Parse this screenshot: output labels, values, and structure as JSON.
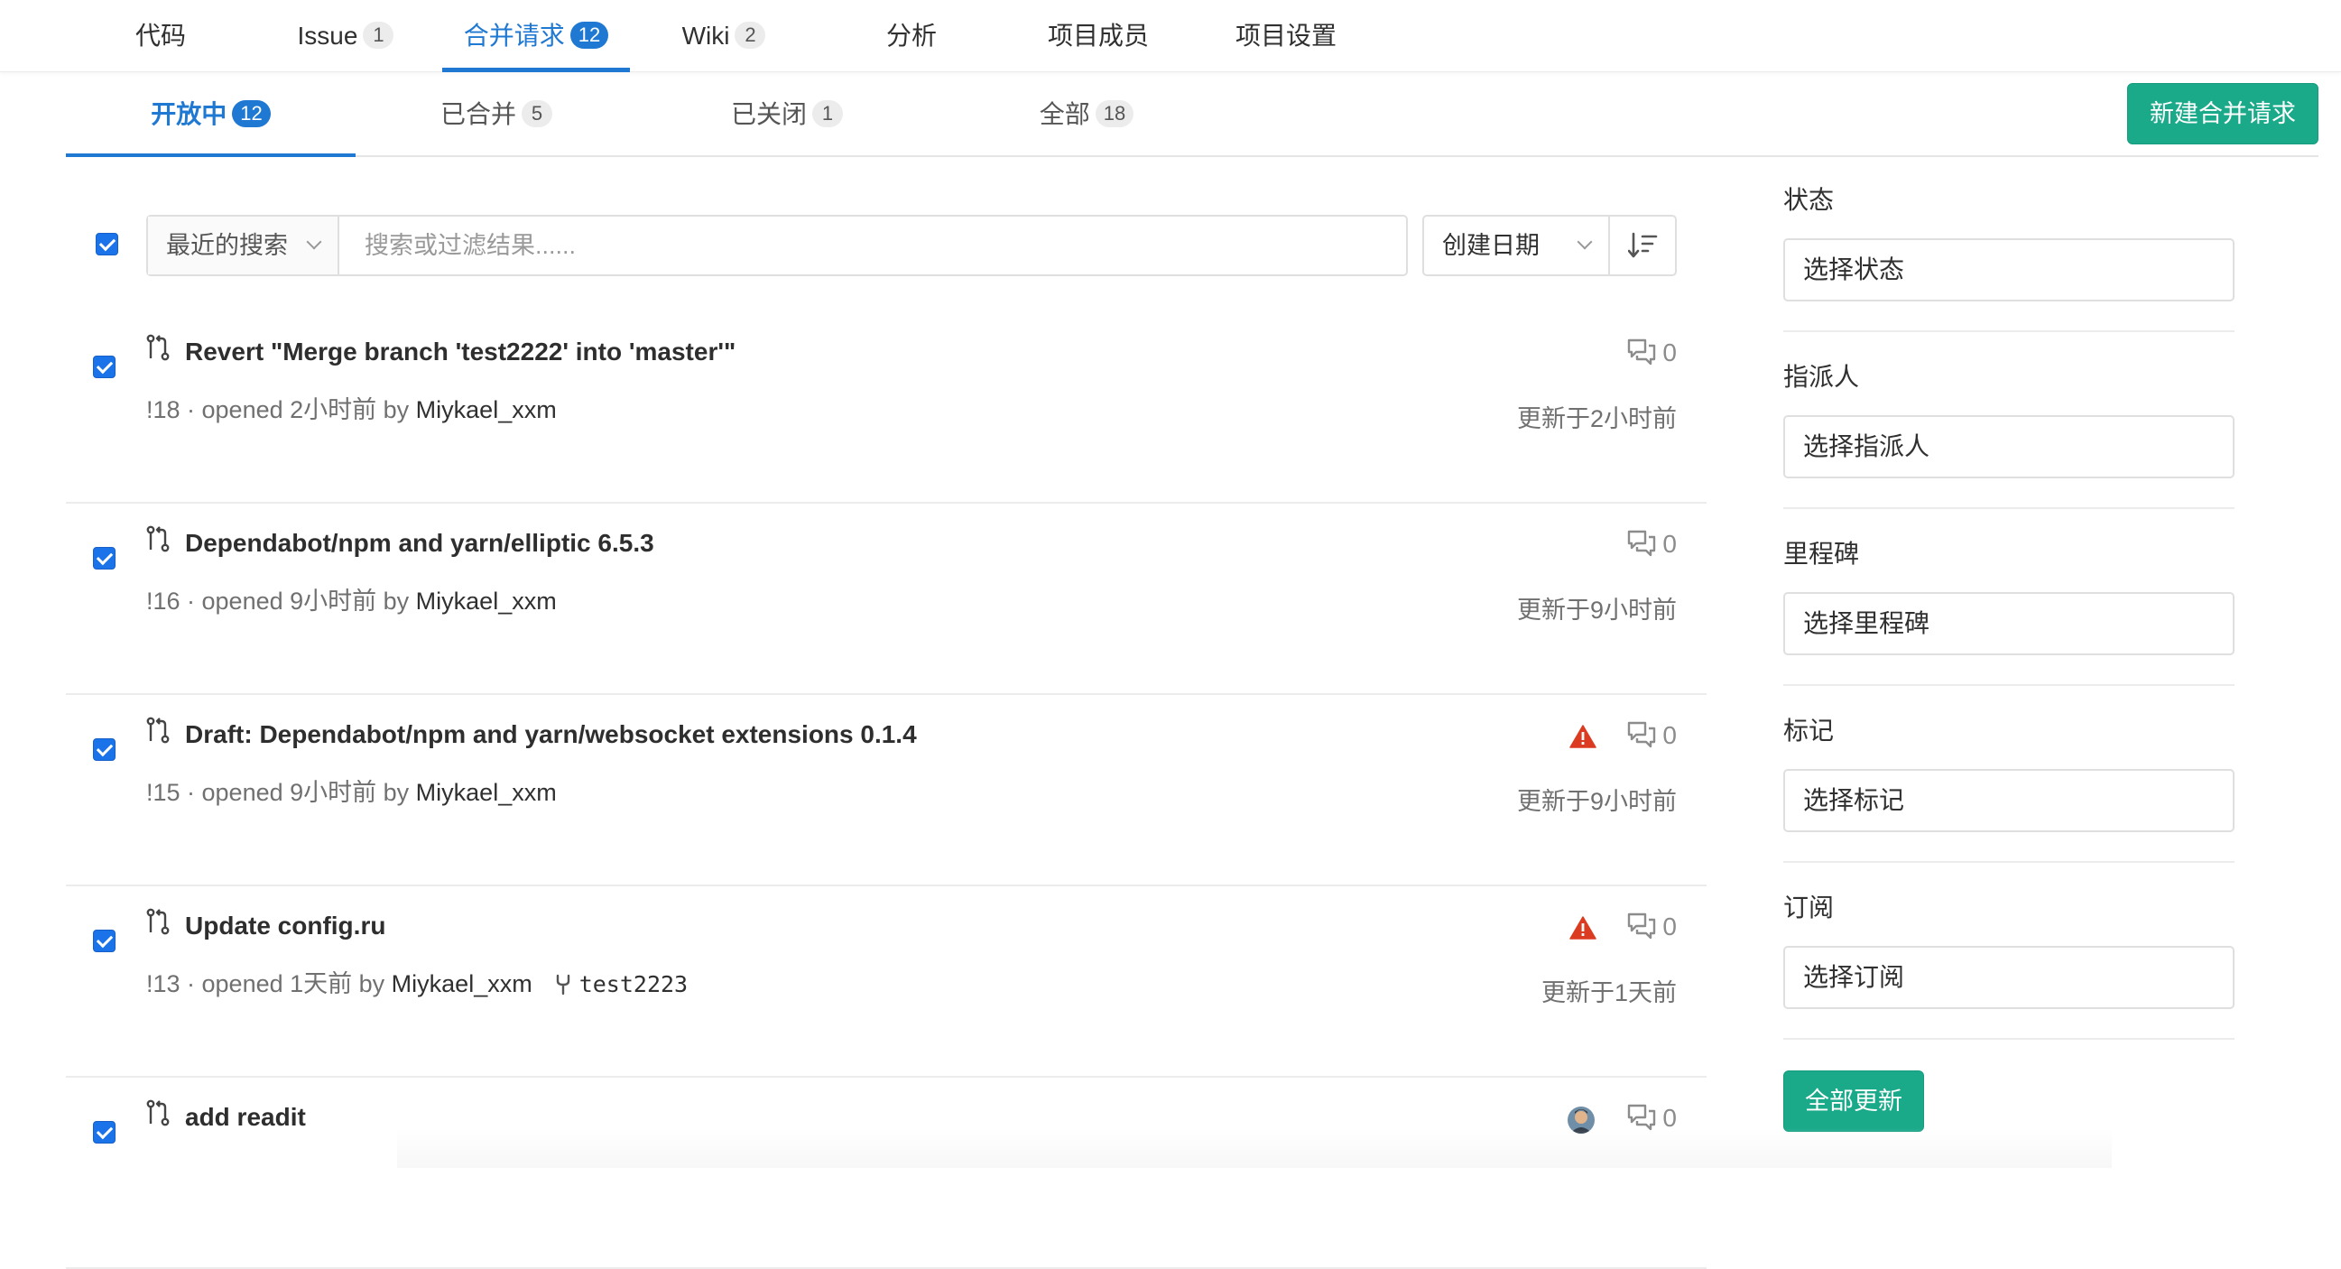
{
  "nav": {
    "tabs": [
      {
        "label": "代码",
        "count": null
      },
      {
        "label": "Issue",
        "count": "1"
      },
      {
        "label": "合并请求",
        "count": "12"
      },
      {
        "label": "Wiki",
        "count": "2"
      },
      {
        "label": "分析",
        "count": null
      },
      {
        "label": "项目成员",
        "count": null
      },
      {
        "label": "项目设置",
        "count": null
      }
    ],
    "active": "合并请求"
  },
  "states": {
    "tabs": [
      {
        "label": "开放中",
        "count": "12"
      },
      {
        "label": "已合并",
        "count": "5"
      },
      {
        "label": "已关闭",
        "count": "1"
      },
      {
        "label": "全部",
        "count": "18"
      }
    ],
    "active": "开放中",
    "new_button": "新建合并请求"
  },
  "filter": {
    "recent_label": "最近的搜索",
    "placeholder": "搜索或过滤结果......",
    "sort_label": "创建日期"
  },
  "merge_requests": [
    {
      "title": "Revert \"Merge branch 'test2222' into 'master'\"",
      "meta": "!18 · opened 2小时前 by ",
      "author": "Miykael_xxm",
      "branch": "",
      "updated": "更新于2小时前",
      "comments": "0",
      "warning": false,
      "avatar": false
    },
    {
      "title": "Dependabot/npm and yarn/elliptic 6.5.3",
      "meta": "!16 · opened 9小时前 by ",
      "author": "Miykael_xxm",
      "branch": "",
      "updated": "更新于9小时前",
      "comments": "0",
      "warning": false,
      "avatar": false
    },
    {
      "title": "Draft: Dependabot/npm and yarn/websocket extensions 0.1.4",
      "meta": "!15 · opened 9小时前 by ",
      "author": "Miykael_xxm",
      "branch": "",
      "updated": "更新于9小时前",
      "comments": "0",
      "warning": true,
      "avatar": false
    },
    {
      "title": "Update config.ru",
      "meta": "!13 · opened 1天前 by ",
      "author": "Miykael_xxm",
      "branch": "test2223",
      "updated": "更新于1天前",
      "comments": "0",
      "warning": true,
      "avatar": false
    },
    {
      "title": "add readit",
      "meta": "",
      "author": "",
      "branch": "",
      "updated": "",
      "comments": "0",
      "warning": false,
      "avatar": true
    }
  ],
  "sidebar": {
    "sections": [
      {
        "label": "状态",
        "placeholder": "选择状态"
      },
      {
        "label": "指派人",
        "placeholder": "选择指派人"
      },
      {
        "label": "里程碑",
        "placeholder": "选择里程碑"
      },
      {
        "label": "标记",
        "placeholder": "选择标记"
      },
      {
        "label": "订阅",
        "placeholder": "选择订阅"
      }
    ],
    "update_button": "全部更新"
  },
  "colors": {
    "accent": "#1f78d1",
    "primary_button": "#1aaa8a",
    "warning": "#db3b21"
  },
  "icons": {
    "merge_request": "merge-request-icon",
    "comments": "comments-icon",
    "warning": "warning-icon",
    "branch": "fork-icon",
    "sort": "sort-direction-icon"
  }
}
